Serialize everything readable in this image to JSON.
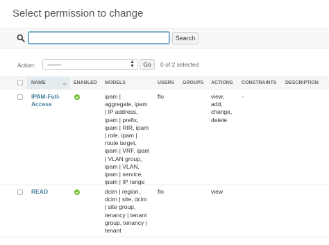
{
  "page": {
    "title": "Select permission to change"
  },
  "search": {
    "value": "",
    "button_label": "Search"
  },
  "actions": {
    "label": "Action:",
    "selected": "---------",
    "go_label": "Go",
    "selection_count": "0 of 2 selected"
  },
  "table": {
    "columns": [
      "NAME",
      "ENABLED",
      "MODELS",
      "USERS",
      "GROUPS",
      "ACTIONS",
      "CONSTRAINTS",
      "DESCRIPTION"
    ],
    "rows": [
      {
        "name_lines": [
          "IPAM-Full-",
          "Access"
        ],
        "enabled": true,
        "models_lines": [
          "ipam |",
          "aggregate, ipam",
          "| IP address,",
          "ipam | prefix,",
          "ipam | RIR, ipam",
          "| role, ipam |",
          "route target,",
          "ipam | VRF, ipam",
          "| VLAN group,",
          "ipam | VLAN,",
          "ipam | service,",
          "ipam | IP range"
        ],
        "users": "flo",
        "groups": "",
        "actions_lines": [
          "view,",
          "add,",
          "change,",
          "delete"
        ],
        "constraints": "-",
        "description": ""
      },
      {
        "name_lines": [
          "READ"
        ],
        "enabled": true,
        "models_lines": [
          "dcim | region,",
          "dcim | site, dcim",
          "| site group,",
          "tenancy | tenant",
          "group, tenancy |",
          "tenant"
        ],
        "users": "flo",
        "groups": "",
        "actions_lines": [
          "view"
        ],
        "constraints": "",
        "description": ""
      }
    ]
  },
  "colors": {
    "accent": "#79aec8",
    "link": "#447e9b",
    "enabled_icon": "#70bf2b"
  }
}
